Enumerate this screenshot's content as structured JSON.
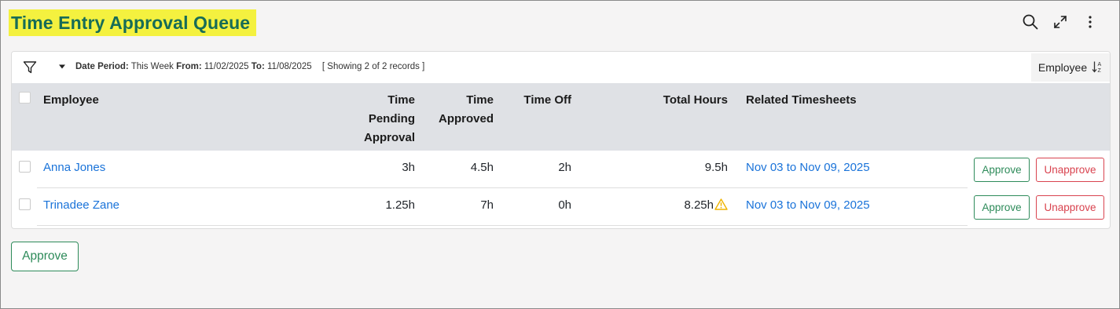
{
  "page": {
    "title": "Time Entry Approval Queue"
  },
  "toolbar_icons": [
    "search-icon",
    "expand-icon",
    "more-vertical-icon"
  ],
  "filter": {
    "date_period_label": "Date Period:",
    "date_period_value": "This Week",
    "from_label": "From:",
    "from_value": "11/02/2025",
    "to_label": "To:",
    "to_value": "11/08/2025",
    "records_text": "[ Showing 2 of 2 records ]",
    "sort_label": "Employee"
  },
  "table": {
    "headers": {
      "employee": "Employee",
      "time_pending_l1": "Time",
      "time_pending_l2": "Pending",
      "time_pending_l3": "Approval",
      "time_approved_l1": "Time",
      "time_approved_l2": "Approved",
      "time_off": "Time Off",
      "total_hours": "Total Hours",
      "related": "Related Timesheets"
    },
    "rows": [
      {
        "employee": "Anna Jones",
        "time_pending": "3h",
        "time_approved": "4.5h",
        "time_off": "2h",
        "total_hours": "9.5h",
        "warning": false,
        "related": "Nov 03 to Nov 09, 2025",
        "approve_label": "Approve",
        "unapprove_label": "Unapprove"
      },
      {
        "employee": "Trinadee Zane",
        "time_pending": "1.25h",
        "time_approved": "7h",
        "time_off": "0h",
        "total_hours": "8.25h",
        "warning": true,
        "related": "Nov 03 to Nov 09, 2025",
        "approve_label": "Approve",
        "unapprove_label": "Unapprove"
      }
    ]
  },
  "bulk": {
    "approve_label": "Approve"
  },
  "colors": {
    "title_highlight": "#f4f13f",
    "title_text": "#176c57",
    "link": "#1a73d9",
    "approve": "#2e8b5a",
    "unapprove": "#d9434f",
    "warning": "#f0b400",
    "header_bg": "#dfe1e5"
  }
}
